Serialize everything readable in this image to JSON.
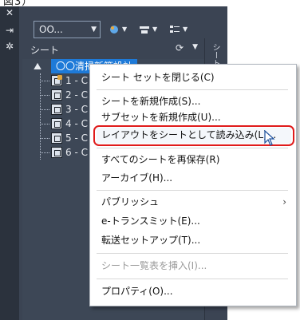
{
  "top_fragment": "図3）",
  "toolbar": {
    "combo_value": "OO...",
    "buttons": [
      "publish-icon",
      "sheet-view-icon",
      "sheet-list-icon"
    ]
  },
  "panel": {
    "title": "シート",
    "refresh": "⟳",
    "side_tab": "シート"
  },
  "tree": {
    "root_label": "〇〇清掃新築設計",
    "rows": [
      {
        "label": "1 - C",
        "marked": true
      },
      {
        "label": "2 - C",
        "marked": false
      },
      {
        "label": "3 - C",
        "marked": false
      },
      {
        "label": "4 - C",
        "marked": false
      },
      {
        "label": "5 - C",
        "marked": false
      },
      {
        "label": "6 - C",
        "marked": false
      }
    ]
  },
  "context_menu": {
    "items": [
      {
        "label": "シート セットを閉じる(C)",
        "disabled": false
      },
      {
        "label": "シートを新規作成(S)...",
        "disabled": false
      },
      {
        "label": "サブセットを新規作成(U)...",
        "disabled": false
      },
      {
        "label": "レイアウトをシートとして読み込み(L)...",
        "disabled": false,
        "highlighted": true
      },
      {
        "label": "すべてのシートを再保存(R)",
        "disabled": false
      },
      {
        "label": "アーカイブ(H)...",
        "disabled": false
      },
      {
        "label": "パブリッシュ",
        "disabled": false,
        "submenu": true
      },
      {
        "label": "e-トランスミット(E)...",
        "disabled": false
      },
      {
        "label": "転送セットアップ(T)...",
        "disabled": false
      },
      {
        "label": "シート一覧表を挿入(I)...",
        "disabled": true
      },
      {
        "label": "プロパティ(O)...",
        "disabled": false
      }
    ]
  },
  "colors": {
    "palette_bg": "#3b4453",
    "selection": "#1e7ad8",
    "highlight_ring": "#e01b1b"
  }
}
